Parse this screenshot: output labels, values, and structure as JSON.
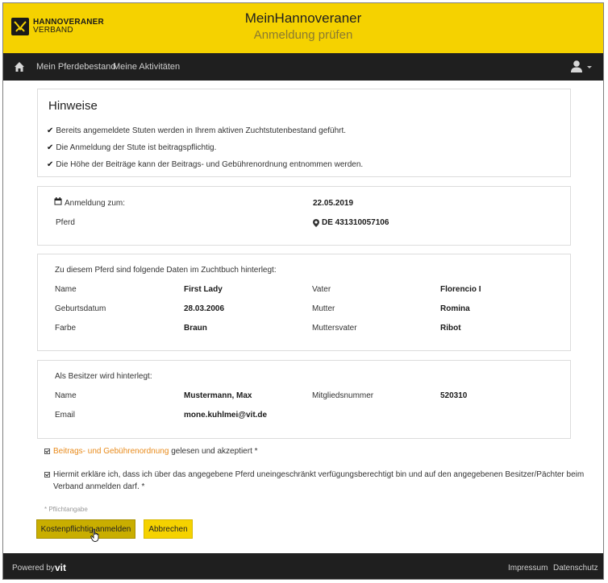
{
  "header": {
    "logo_line1": "HANNOVERANER",
    "logo_line2": "VERBAND",
    "app_title": "MeinHannoveraner",
    "page_subtitle": "Anmeldung prüfen",
    "brand_color": "#f5d200"
  },
  "nav": {
    "home_icon": "home-icon",
    "items": [
      "Mein Pferdebestand",
      "Meine Aktivitäten"
    ],
    "user_icon": "user-icon"
  },
  "hints": {
    "title": "Hinweise",
    "items": [
      "Bereits angemeldete Stuten werden in Ihrem aktiven Zuchtstutenbestand geführt.",
      "Die Anmeldung der Stute ist beitragspflichtig.",
      "Die Höhe der Beiträge kann der Beitrags- und Gebührenordnung entnommen werden."
    ]
  },
  "registration": {
    "date_label": "Anmeldung zum:",
    "date_value": "22.05.2019",
    "horse_label": "Pferd",
    "horse_value": "DE 431310057106"
  },
  "studbook": {
    "intro": "Zu diesem Pferd sind folgende Daten im Zuchtbuch hinterlegt:",
    "rows": [
      {
        "l1": "Name",
        "v1": "First Lady",
        "l2": "Vater",
        "v2": "Florencio I"
      },
      {
        "l1": "Geburtsdatum",
        "v1": "28.03.2006",
        "l2": "Mutter",
        "v2": "Romina"
      },
      {
        "l1": "Farbe",
        "v1": "Braun",
        "l2": "Muttersvater",
        "v2": "Ribot"
      }
    ]
  },
  "owner": {
    "intro": "Als Besitzer wird hinterlegt:",
    "name_label": "Name",
    "name_value": "Mustermann, Max",
    "member_label": "Mitgliedsnummer",
    "member_value": "520310",
    "email_label": "Email",
    "email_value": "mone.kuhlmei@vit.de"
  },
  "consent": {
    "c1_link": "Beitrags- und Gebührenordnung",
    "c1_rest": " gelesen und akzeptiert *",
    "c2_line1": "Hiermit erkläre ich, dass ich über das angegebene Pferd uneingeschränkt verfügungsberechtigt bin und auf den angegebenen Besitzer/Pächter beim",
    "c2_line2": "Verband anmelden darf. *",
    "required_note": "* Pflichtangabe"
  },
  "buttons": {
    "submit": "Kostenpflichtig anmelden",
    "cancel": "Abbrechen"
  },
  "footer": {
    "powered": "Powered by",
    "vit": "vit",
    "impressum": "Impressum",
    "datenschutz": "Datenschutz"
  }
}
